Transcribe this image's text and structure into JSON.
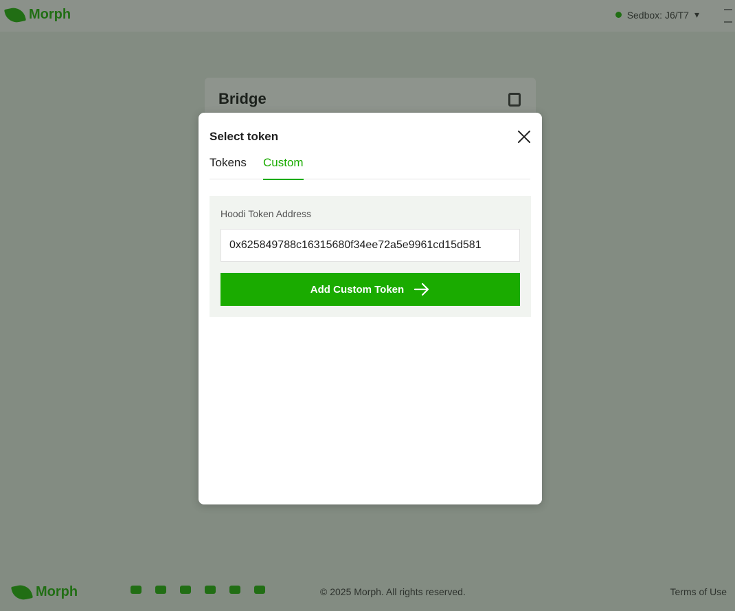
{
  "header": {
    "brand": "Morph",
    "network_label": "Sedbox: J6/T7"
  },
  "bridge": {
    "title": "Bridge"
  },
  "footer": {
    "brand": "Morph",
    "copyright": "© 2025 Morph. All rights reserved.",
    "terms": "Terms of Use"
  },
  "modal": {
    "title": "Select token",
    "tabs": [
      {
        "label": "Tokens",
        "active": false
      },
      {
        "label": "Custom",
        "active": true
      }
    ],
    "custom": {
      "field_label": "Hoodi Token Address",
      "address_value": "0x625849788c16315680f34ee72a5e9961cd15d581",
      "add_button_label": "Add Custom Token"
    }
  },
  "colors": {
    "accent": "#1aab00",
    "panel_bg": "#f1f4f0",
    "overlay": "rgba(40,50,40,0.5)"
  },
  "icons": {
    "close": "close-icon",
    "arrow": "arrow-right-icon"
  }
}
